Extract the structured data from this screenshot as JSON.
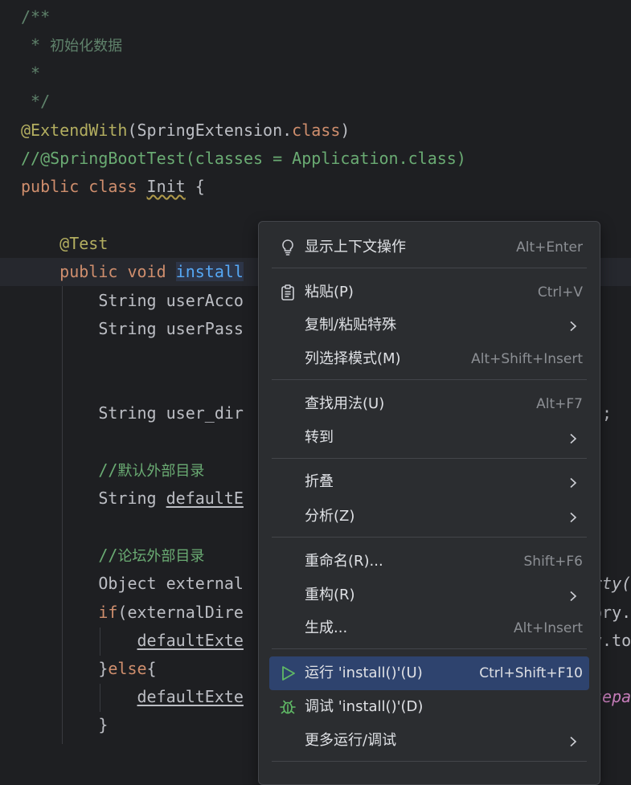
{
  "editor": {
    "lines": [
      {
        "tokens": [
          {
            "t": "/**",
            "c": "doc"
          }
        ]
      },
      {
        "tokens": [
          {
            "t": " * ",
            "c": "doc"
          },
          {
            "t": "初始化数据",
            "c": "doc doc-cn"
          }
        ]
      },
      {
        "tokens": [
          {
            "t": " *",
            "c": "doc"
          }
        ]
      },
      {
        "tokens": [
          {
            "t": " */",
            "c": "doc"
          }
        ]
      },
      {
        "tokens": [
          {
            "t": "@ExtendWith",
            "c": "ann"
          },
          {
            "t": "(SpringExtension.",
            "c": ""
          },
          {
            "t": "class",
            "c": "kw"
          },
          {
            "t": ")",
            "c": ""
          }
        ]
      },
      {
        "tokens": [
          {
            "t": "//@SpringBootTest(classes = Application.class)",
            "c": "str"
          }
        ]
      },
      {
        "tokens": [
          {
            "t": "public class ",
            "c": "kw"
          },
          {
            "t": "Init",
            "c": "wavy"
          },
          {
            "t": " {",
            "c": ""
          }
        ]
      },
      {
        "tokens": []
      },
      {
        "tokens": [
          {
            "t": "    @Test",
            "c": "ann"
          }
        ]
      },
      {
        "tokens": [
          {
            "t": "    public void ",
            "c": "kw"
          },
          {
            "t": "install",
            "c": "fn"
          }
        ],
        "current": true
      },
      {
        "tokens": [
          {
            "t": "        String userAcco",
            "c": ""
          }
        ]
      },
      {
        "tokens": [
          {
            "t": "        String userPass",
            "c": ""
          }
        ]
      },
      {
        "tokens": []
      },
      {
        "tokens": [
          {
            "t": "        String user_dir",
            "c": ""
          }
        ],
        "tail": ");"
      },
      {
        "tokens": []
      },
      {
        "tokens": [
          {
            "t": "        //",
            "c": "str"
          },
          {
            "t": "默认外部目录",
            "c": "str doc-cn"
          }
        ]
      },
      {
        "tokens": [
          {
            "t": "        String ",
            "c": ""
          },
          {
            "t": "defaultE",
            "c": "uline"
          }
        ]
      },
      {
        "tokens": []
      },
      {
        "tokens": [
          {
            "t": "        //",
            "c": "str"
          },
          {
            "t": "论坛外部目录",
            "c": "str doc-cn"
          }
        ]
      },
      {
        "tokens": [
          {
            "t": "        Object external",
            "c": ""
          }
        ],
        "tail": "rty(",
        "tailClass": "italic-plain"
      },
      {
        "tokens": [
          {
            "t": "        if",
            "c": "kw"
          },
          {
            "t": "(externalDire",
            "c": ""
          }
        ],
        "tail": "ory."
      },
      {
        "tokens": [
          {
            "t": "            ",
            "c": ""
          },
          {
            "t": "defaultExte",
            "c": "uline"
          }
        ],
        "tail": "y.to"
      },
      {
        "tokens": [
          {
            "t": "        }",
            "c": ""
          },
          {
            "t": "else",
            "c": "kw"
          },
          {
            "t": "{",
            "c": ""
          }
        ]
      },
      {
        "tokens": [
          {
            "t": "            ",
            "c": ""
          },
          {
            "t": "defaultExte",
            "c": "uline"
          }
        ],
        "tail": "sepa",
        "tailClass": "italic-purple"
      },
      {
        "tokens": [
          {
            "t": "        }",
            "c": ""
          }
        ]
      }
    ]
  },
  "context_menu": {
    "items": [
      {
        "label": "显示上下文操作",
        "shortcut": "Alt+Enter",
        "icon": "lightbulb-icon"
      },
      {
        "label": "粘贴(P)",
        "shortcut": "Ctrl+V",
        "icon": "clipboard-icon",
        "mnemonic": "P"
      },
      {
        "label": "复制/粘贴特殊",
        "submenu": true
      },
      {
        "label": "列选择模式(M)",
        "shortcut": "Alt+Shift+Insert",
        "mnemonic": "M"
      },
      {
        "label": "查找用法(U)",
        "shortcut": "Alt+F7",
        "mnemonic": "U"
      },
      {
        "label": "转到",
        "submenu": true
      },
      {
        "label": "折叠",
        "submenu": true
      },
      {
        "label": "分析(Z)",
        "submenu": true,
        "mnemonic": "Z"
      },
      {
        "label": "重命名(R)...",
        "shortcut": "Shift+F6",
        "mnemonic": "R"
      },
      {
        "label": "重构(R)",
        "submenu": true,
        "mnemonic": "R"
      },
      {
        "label": "生成...",
        "shortcut": "Alt+Insert"
      },
      {
        "label": "运行 'install()'(U)",
        "shortcut": "Ctrl+Shift+F10",
        "icon": "run-icon",
        "mnemonic": "U",
        "selected": true
      },
      {
        "label": "调试 'install()'(D)",
        "icon": "debug-icon",
        "mnemonic": "D"
      },
      {
        "label": "更多运行/调试",
        "submenu": true
      }
    ]
  },
  "colors": {
    "background": "#1e1f22",
    "menu_background": "#2b2d30",
    "selection": "#2e436e",
    "keyword": "#cf8e6d",
    "annotation": "#b3ae60",
    "doc_comment": "#5f826b",
    "method": "#56a8f5",
    "run_icon": "#5fb865"
  }
}
